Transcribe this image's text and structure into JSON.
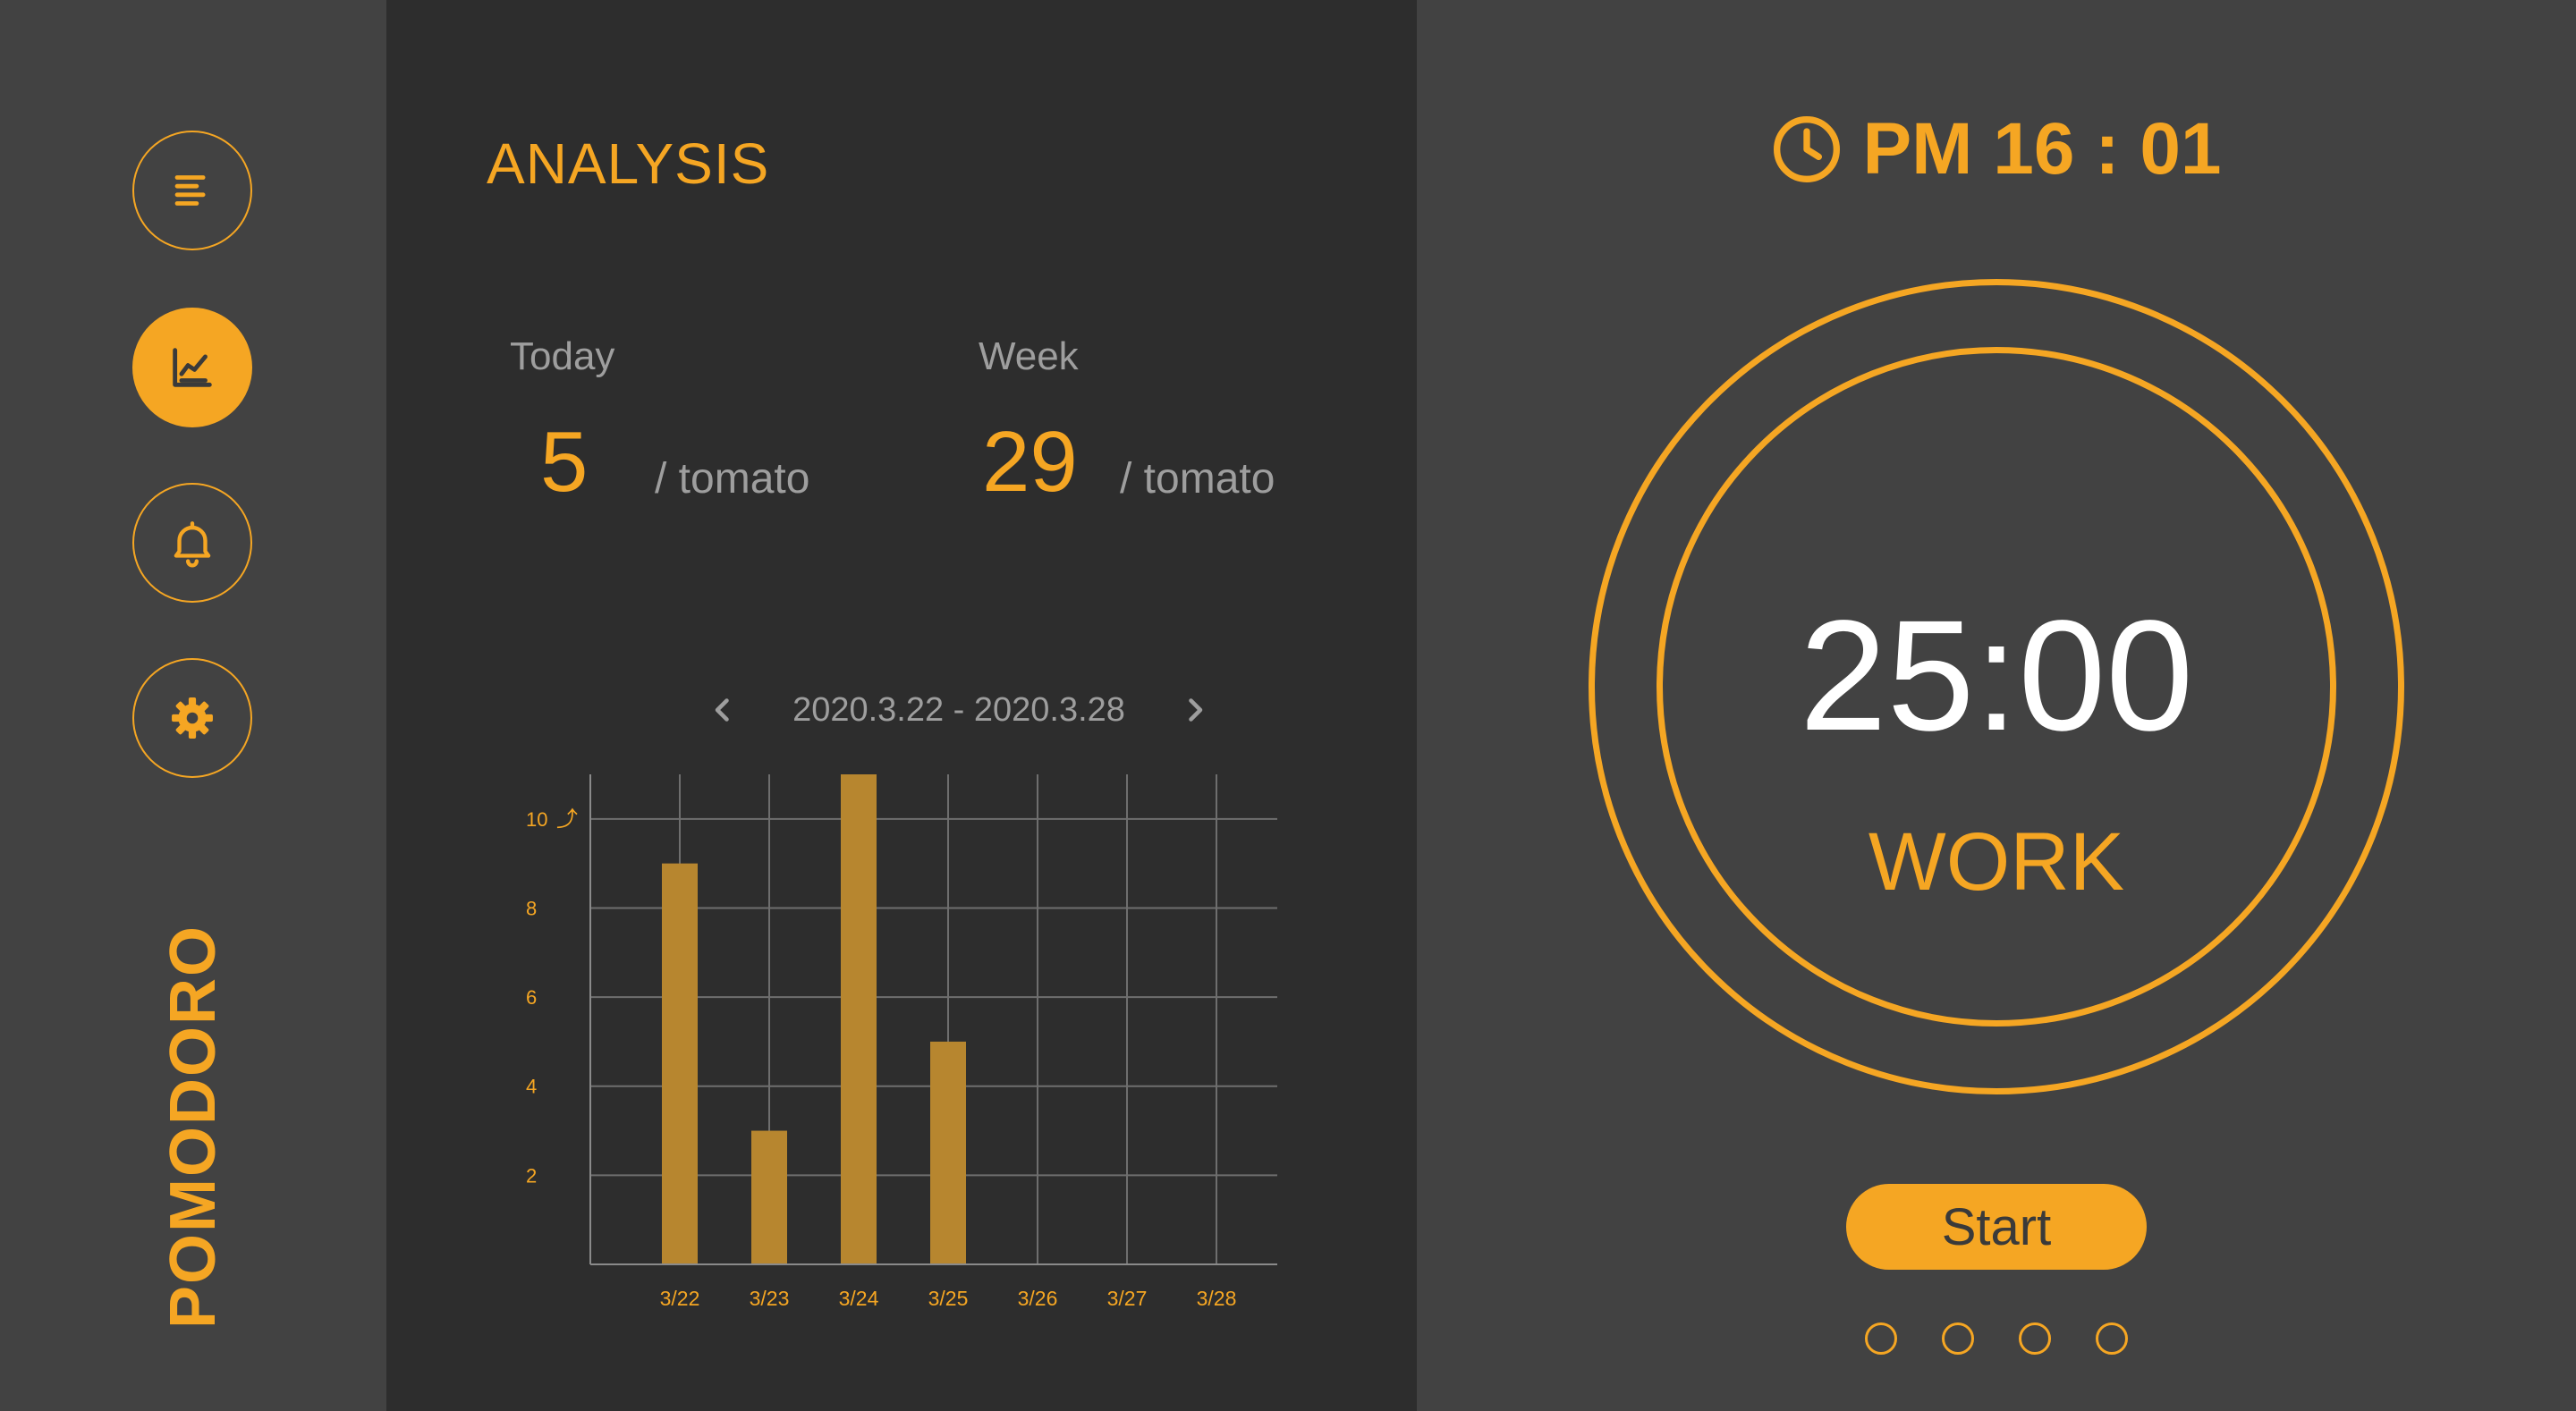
{
  "brand": "POMODORO",
  "colors": {
    "accent": "#F5A623",
    "panel_dark": "#2d2d2d",
    "panel": "#424242",
    "muted": "#9e9e9e"
  },
  "nav": [
    {
      "icon": "list-icon",
      "active": false
    },
    {
      "icon": "chart-icon",
      "active": true
    },
    {
      "icon": "bell-icon",
      "active": false
    },
    {
      "icon": "gear-icon",
      "active": false
    }
  ],
  "analysis": {
    "title": "ANALYSIS",
    "today": {
      "label": "Today",
      "value": "5",
      "unit": "/ tomato"
    },
    "week": {
      "label": "Week",
      "value": "29",
      "unit": "/ tomato"
    },
    "range": "2020.3.22 - 2020.3.28"
  },
  "chart_data": {
    "type": "bar",
    "categories": [
      "3/22",
      "3/23",
      "3/24",
      "3/25",
      "3/26",
      "3/27",
      "3/28"
    ],
    "values": [
      9,
      3,
      11,
      5,
      0,
      0,
      0
    ],
    "yticks": [
      "2",
      "4",
      "6",
      "8",
      "10"
    ],
    "ylim": [
      0,
      11
    ],
    "grid": true,
    "overflow_marker": "⤴",
    "bar_color": "#B7862F"
  },
  "timer": {
    "clock": "PM 16 : 01",
    "time": "25:00",
    "mode": "WORK",
    "start_label": "Start",
    "sessions_total": 4,
    "sessions_done": 0
  }
}
